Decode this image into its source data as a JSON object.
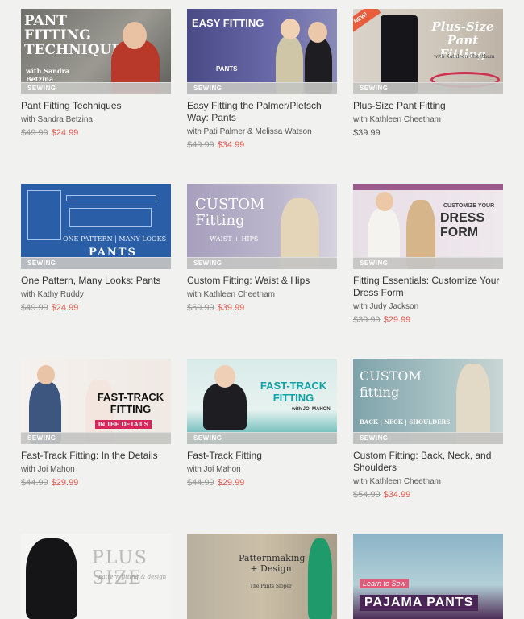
{
  "courses": [
    {
      "title": "Pant Fitting Techniques",
      "instructor": "with Sandra Betzina",
      "category": "SEWING",
      "orig": "$49.99",
      "price": "$24.99",
      "thumb_text": "PANT FITTING TECHNIQUES",
      "thumb_sub": "with Sandra Betzina"
    },
    {
      "title": "Easy Fitting the Palmer/Pletsch Way: Pants",
      "instructor": "with Pati Palmer & Melissa Watson",
      "category": "SEWING",
      "orig": "$49.99",
      "price": "$34.99",
      "thumb_text": "EASY FITTING",
      "thumb_sub": "PANTS"
    },
    {
      "title": "Plus-Size Pant Fitting",
      "instructor": "with Kathleen Cheetham",
      "category": "SEWING",
      "orig": "",
      "price": "$39.99",
      "thumb_text": "Plus-Size Pant Fitting",
      "thumb_sub": "with Kathleen Cheetham",
      "badge": "NEW!"
    },
    {
      "title": "One Pattern, Many Looks: Pants",
      "instructor": "with Kathy Ruddy",
      "category": "SEWING",
      "orig": "$49.99",
      "price": "$24.99",
      "thumb_text": "PANTS",
      "thumb_sub": "ONE PATTERN | MANY LOOKS"
    },
    {
      "title": "Custom Fitting: Waist & Hips",
      "instructor": "with Kathleen Cheetham",
      "category": "SEWING",
      "orig": "$59.99",
      "price": "$39.99",
      "thumb_text": "CUSTOM Fitting",
      "thumb_sub": "WAIST + HIPS"
    },
    {
      "title": "Fitting Essentials: Customize Your Dress Form",
      "instructor": "with Judy Jackson",
      "category": "SEWING",
      "orig": "$39.99",
      "price": "$29.99",
      "thumb_text": "DRESS FORM",
      "thumb_sub": "CUSTOMIZE YOUR"
    },
    {
      "title": "Fast-Track Fitting: In the Details",
      "instructor": "with Joi Mahon",
      "category": "SEWING",
      "orig": "$44.99",
      "price": "$29.99",
      "thumb_text": "FAST-TRACK FITTING",
      "thumb_sub": "IN THE DETAILS"
    },
    {
      "title": "Fast-Track Fitting",
      "instructor": "with Joi Mahon",
      "category": "SEWING",
      "orig": "$44.99",
      "price": "$29.99",
      "thumb_text": "FAST-TRACK FITTING",
      "thumb_sub": "with JOI MAHON"
    },
    {
      "title": "Custom Fitting: Back, Neck, and Shoulders",
      "instructor": "with Kathleen Cheetham",
      "category": "SEWING",
      "orig": "$54.99",
      "price": "$34.99",
      "thumb_text": "CUSTOM fitting",
      "thumb_sub": "BACK | NECK | SHOULDERS"
    },
    {
      "title": "",
      "instructor": "",
      "category": "",
      "orig": "",
      "price": "",
      "thumb_text": "PLUS SIZE",
      "thumb_sub": "pattern fitting & design"
    },
    {
      "title": "",
      "instructor": "",
      "category": "",
      "orig": "",
      "price": "",
      "thumb_text": "Patternmaking + Design",
      "thumb_sub": "The Pants Sloper"
    },
    {
      "title": "",
      "instructor": "",
      "category": "",
      "orig": "",
      "price": "",
      "thumb_text": "PAJAMA PANTS",
      "thumb_sub": "Learn to Sew"
    }
  ]
}
